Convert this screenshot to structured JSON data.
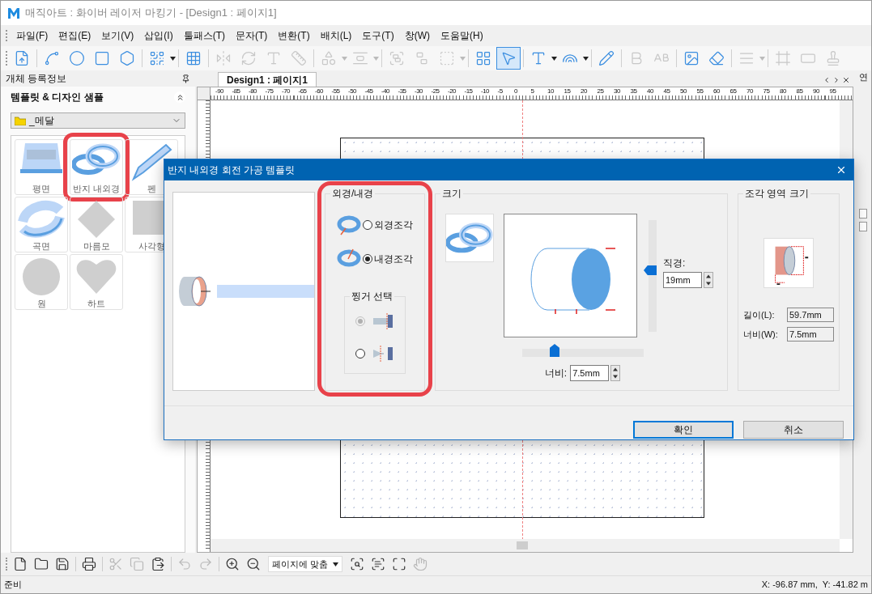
{
  "window": {
    "title": "매직아트 : 화이버 레이저 마킹기 - [Design1 : 페이지1]"
  },
  "menu": [
    "파일(F)",
    "편집(E)",
    "보기(V)",
    "삽입(I)",
    "툴패스(T)",
    "문자(T)",
    "변환(T)",
    "배치(L)",
    "도구(T)",
    "창(W)",
    "도움말(H)"
  ],
  "toolbar": {
    "tools": [
      {
        "selected": false,
        "disabled": false,
        "dropdown": false
      },
      {
        "selected": false,
        "disabled": false,
        "dropdown": false
      },
      {
        "selected": false,
        "disabled": false,
        "dropdown": false
      },
      {
        "selected": false,
        "disabled": false,
        "dropdown": false
      },
      {
        "selected": false,
        "disabled": false,
        "dropdown": false
      },
      {
        "selected": false,
        "disabled": false,
        "dropdown": true
      },
      {
        "selected": false,
        "disabled": false,
        "dropdown": false
      },
      {
        "selected": false,
        "disabled": true,
        "dropdown": false
      },
      {
        "selected": false,
        "disabled": true,
        "dropdown": false
      },
      {
        "selected": false,
        "disabled": true,
        "dropdown": false
      },
      {
        "selected": false,
        "disabled": true,
        "dropdown": false
      },
      {
        "selected": false,
        "disabled": true,
        "dropdown": true
      },
      {
        "selected": false,
        "disabled": true,
        "dropdown": true
      },
      {
        "selected": false,
        "disabled": true,
        "dropdown": false
      },
      {
        "selected": false,
        "disabled": true,
        "dropdown": false
      },
      {
        "selected": false,
        "disabled": true,
        "dropdown": true
      },
      {
        "selected": false,
        "disabled": false,
        "dropdown": false
      },
      {
        "selected": true,
        "disabled": false,
        "dropdown": false
      },
      {
        "selected": false,
        "disabled": false,
        "dropdown": true
      },
      {
        "selected": false,
        "disabled": false,
        "dropdown": true
      },
      {
        "selected": false,
        "disabled": false,
        "dropdown": false
      },
      {
        "selected": false,
        "disabled": true,
        "dropdown": false
      },
      {
        "selected": false,
        "disabled": true,
        "dropdown": false
      },
      {
        "selected": false,
        "disabled": false,
        "dropdown": false
      },
      {
        "selected": false,
        "disabled": false,
        "dropdown": false
      },
      {
        "selected": false,
        "disabled": true,
        "dropdown": true
      },
      {
        "selected": false,
        "disabled": true,
        "dropdown": false
      },
      {
        "selected": false,
        "disabled": true,
        "dropdown": false
      },
      {
        "selected": false,
        "disabled": true,
        "dropdown": false
      }
    ]
  },
  "left_panel": {
    "title": "개체 등록정보",
    "section": "템플릿 & 디자인 샘플",
    "folder": "_메달",
    "templates": [
      {
        "label": "평면",
        "kind": "flat",
        "highlighted": false
      },
      {
        "label": "반지 내외경",
        "kind": "ring",
        "highlighted": true
      },
      {
        "label": "펜",
        "kind": "pen",
        "highlighted": false
      },
      {
        "label": "곡면",
        "kind": "curved",
        "highlighted": false
      },
      {
        "label": "마름모",
        "kind": "diamond",
        "highlighted": false
      },
      {
        "label": "사각형",
        "kind": "square",
        "highlighted": false
      },
      {
        "label": "원",
        "kind": "circle",
        "highlighted": false
      },
      {
        "label": "하트",
        "kind": "heart",
        "highlighted": false
      }
    ]
  },
  "document_tab": {
    "label": "Design1 : 페이지1",
    "selected": true
  },
  "right_panel": {
    "tab": "연"
  },
  "ruler": {
    "labels": [
      "-90",
      "-85",
      "-80",
      "-75",
      "-70",
      "-65",
      "-60",
      "-55",
      "-50",
      "-45",
      "-40",
      "-35",
      "-30",
      "-25",
      "-20",
      "-15",
      "-10",
      "-5",
      "0",
      "5",
      "10",
      "15",
      "20",
      "25",
      "30",
      "35",
      "40",
      "45",
      "50",
      "55",
      "60",
      "65",
      "70",
      "75",
      "80",
      "85",
      "90",
      "95"
    ]
  },
  "dialog": {
    "title": "반지 내외경 회전 가공 템플릿",
    "engraving": {
      "title": "외경/내경",
      "highlighted": true,
      "options": [
        {
          "label": "외경조각",
          "selected": false
        },
        {
          "label": "내경조각",
          "selected": true
        }
      ],
      "fixture": {
        "title": "찡거 선택",
        "options": [
          {
            "selected": true,
            "disabled": true
          },
          {
            "selected": false,
            "disabled": false
          }
        ]
      }
    },
    "size": {
      "title": "크기",
      "diameter_label": "직경:",
      "diameter": "19mm",
      "diameter_slider": {
        "level": 0.55
      },
      "width_label": "너비:",
      "width": "7.5mm",
      "width_slider": {
        "level": 0.27
      }
    },
    "area": {
      "title": "조각 영역 크기",
      "length_label": "길이(L):",
      "length": "59.7mm",
      "width_label": "너비(W):",
      "width": "7.5mm"
    },
    "buttons": [
      {
        "label": "확인",
        "default": true
      },
      {
        "label": "취소",
        "default": false
      }
    ]
  },
  "bottom_toolbar": {
    "tools": [
      {
        "disabled": false
      },
      {
        "disabled": false
      },
      {
        "disabled": false
      },
      {
        "disabled": false
      },
      {
        "disabled": true
      },
      {
        "disabled": true
      },
      {
        "disabled": false
      },
      {
        "disabled": true
      },
      {
        "disabled": true
      },
      {
        "disabled": false
      },
      {
        "disabled": false
      },
      {
        "disabled": false
      },
      {
        "disabled": false
      },
      {
        "disabled": false
      },
      {
        "disabled": true
      }
    ],
    "zoom": "페이지에 맞춤"
  },
  "status_bar": {
    "message": "준비",
    "coordinates": "X: -96.87 mm,  Y: -41.82 m"
  }
}
